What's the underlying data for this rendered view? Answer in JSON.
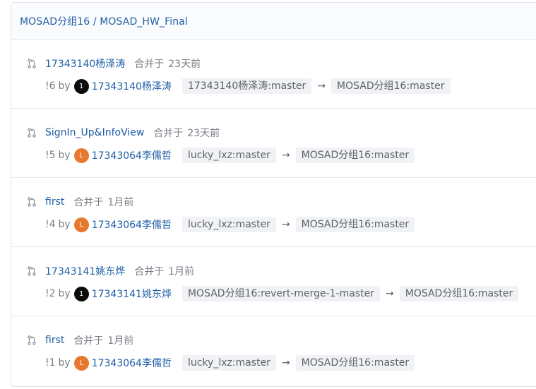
{
  "header": {
    "breadcrumb": "MOSAD分组16 / MOSAD_HW_Final"
  },
  "merge_requests": [
    {
      "title": "17343140杨泽涛",
      "merged_label": "合并于",
      "merged_time": "23天前",
      "id": "!6",
      "by": "by",
      "avatar_letter": "1",
      "avatar_color": "#0b0b0b",
      "author": "17343140杨泽涛",
      "source_branch": "17343140杨泽涛:master",
      "arrow": "→",
      "target_branch": "MOSAD分组16:master"
    },
    {
      "title": "SignIn_Up&InfoView",
      "merged_label": "合并于",
      "merged_time": "23天前",
      "id": "!5",
      "by": "by",
      "avatar_letter": "L",
      "avatar_color": "#e8782e",
      "author": "17343064李儒哲",
      "source_branch": "lucky_lxz:master",
      "arrow": "→",
      "target_branch": "MOSAD分组16:master"
    },
    {
      "title": "first",
      "merged_label": "合并于",
      "merged_time": "1月前",
      "id": "!4",
      "by": "by",
      "avatar_letter": "L",
      "avatar_color": "#e8782e",
      "author": "17343064李儒哲",
      "source_branch": "lucky_lxz:master",
      "arrow": "→",
      "target_branch": "MOSAD分组16:master"
    },
    {
      "title": "17343141姚东烨",
      "merged_label": "合并于",
      "merged_time": "1月前",
      "id": "!2",
      "by": "by",
      "avatar_letter": "1",
      "avatar_color": "#0b0b0b",
      "author": "17343141姚东烨",
      "source_branch": "MOSAD分组16:revert-merge-1-master",
      "arrow": "→",
      "target_branch": "MOSAD分组16:master"
    },
    {
      "title": "first",
      "merged_label": "合并于",
      "merged_time": "1月前",
      "id": "!1",
      "by": "by",
      "avatar_letter": "L",
      "avatar_color": "#e8782e",
      "author": "17343064李儒哲",
      "source_branch": "lucky_lxz:master",
      "arrow": "→",
      "target_branch": "MOSAD分组16:master"
    }
  ],
  "icons": {
    "merge_request": "merge-request-icon"
  }
}
